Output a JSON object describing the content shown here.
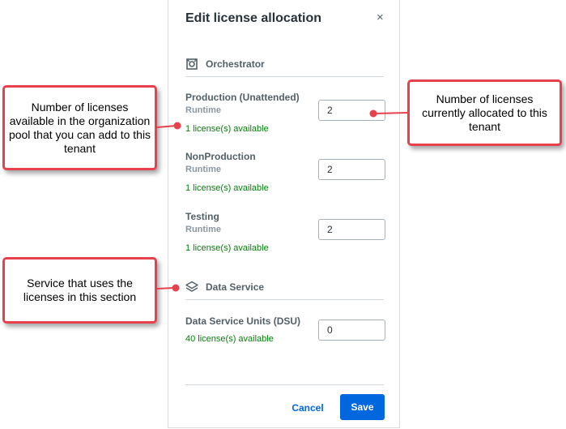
{
  "dialog": {
    "title": "Edit license allocation",
    "close_icon": "×"
  },
  "sections": {
    "orchestrator": {
      "icon": "orchestrator-icon",
      "label": "Orchestrator",
      "rows": [
        {
          "name": "Production (Unattended)",
          "type": "Runtime",
          "available": "1 license(s) available",
          "value": "2"
        },
        {
          "name": "NonProduction",
          "type": "Runtime",
          "available": "1 license(s) available",
          "value": "2"
        },
        {
          "name": "Testing",
          "type": "Runtime",
          "available": "1 license(s) available",
          "value": "2"
        }
      ]
    },
    "data_service": {
      "icon": "layers-icon",
      "label": "Data Service",
      "rows": [
        {
          "name": "Data Service Units (DSU)",
          "available": "40 license(s) available",
          "value": "0"
        }
      ]
    }
  },
  "footer": {
    "cancel_label": "Cancel",
    "save_label": "Save"
  },
  "callouts": {
    "available_pool": "Number of licenses available in the organization pool that you can add to this tenant",
    "allocated": "Number of licenses currently allocated to this tenant",
    "service": "Service that uses the licenses in this section"
  },
  "colors": {
    "accent": "#0067df",
    "available_text": "#038108",
    "callout_border": "#e8414e"
  }
}
